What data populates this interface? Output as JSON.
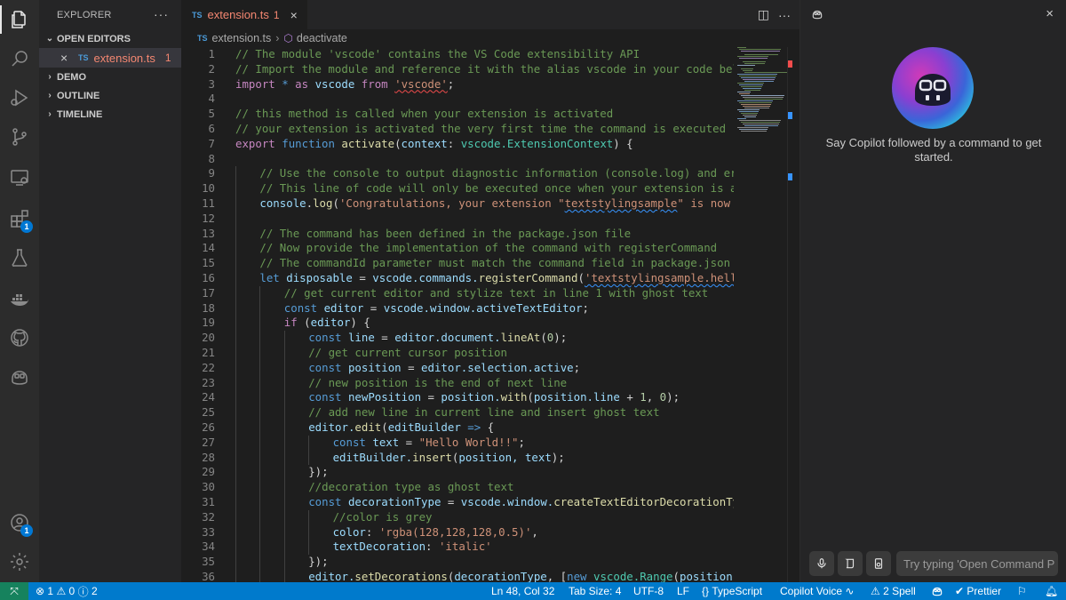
{
  "activity_bar": {
    "items": [
      "explorer-icon",
      "search-icon",
      "run-debug-icon",
      "source-control-icon",
      "remote-explorer-icon",
      "extensions-icon",
      "testing-icon",
      "docker-icon",
      "github-icon",
      "copilot-icon"
    ],
    "extensions_badge": "1",
    "accounts_badge": "1"
  },
  "sidebar": {
    "title": "EXPLORER",
    "more": "···",
    "sections": {
      "open_editors": "OPEN EDITORS",
      "demo": "DEMO",
      "outline": "OUTLINE",
      "timeline": "TIMELINE"
    },
    "open_file": {
      "icon": "TS",
      "name": "extension.ts",
      "problems": "1"
    }
  },
  "editor": {
    "tab": {
      "icon": "TS",
      "name": "extension.ts",
      "problems": "1"
    },
    "breadcrumb": {
      "file": "extension.ts",
      "symbol": "deactivate"
    }
  },
  "code": {
    "line_numbers": [
      "1",
      "2",
      "3",
      "4",
      "5",
      "6",
      "7",
      "8",
      "9",
      "10",
      "11",
      "12",
      "13",
      "14",
      "15",
      "16",
      "17",
      "18",
      "19",
      "20",
      "21",
      "22",
      "23",
      "24",
      "25",
      "26",
      "27",
      "28",
      "29",
      "30",
      "31",
      "32",
      "33",
      "34",
      "35",
      "36"
    ],
    "text": {
      "l1": "// The module 'vscode' contains the VS Code extensibility API",
      "l2": "// Import the module and reference it with the alias vscode in your code below",
      "l3_import": "import",
      "l3_star": "*",
      "l3_as": "as",
      "l3_vscode": "vscode",
      "l3_from": "from",
      "l3_mod": "'vscode'",
      "l5": "// this method is called when your extension is activated",
      "l6": "// your extension is activated the very first time the command is executed",
      "l7_export": "export",
      "l7_function": "function",
      "l7_name": "activate",
      "l7_param": "context",
      "l7_type": "vscode.ExtensionContext",
      "l9": "// Use the console to output diagnostic information (console.log) and errors (co",
      "l10": "// This line of code will only be executed once when your extension is activated",
      "l11_console": "console",
      "l11_log": "log",
      "l11_str1": "'Congratulations, your extension \"",
      "l11_str2": "textstylingsample",
      "l11_str3": "\" is now active!",
      "l13": "// The command has been defined in the package.json file",
      "l14": "// Now provide the implementation of the command with registerCommand",
      "l15": "// The commandId parameter must match the command field in package.json",
      "l16_let": "let",
      "l16_var": "disposable",
      "l16_obj": "vscode.commands.",
      "l16_fn": "registerCommand",
      "l16_str": "'textstylingsample.helloWorld'",
      "l17": "// get current editor and stylize text in line 1 with ghost text",
      "l18_const": "const",
      "l18_var": "editor",
      "l18_rhs": "vscode.window.activeTextEditor",
      "l19_if": "if",
      "l19_var": "editor",
      "l20_const": "const",
      "l20_var": "line",
      "l20_obj": "editor.document.",
      "l20_fn": "lineAt",
      "l20_num": "0",
      "l21": "// get current cursor position",
      "l22_const": "const",
      "l22_var": "position",
      "l22_rhs": "editor.selection.active",
      "l23": "// new position is the end of next line",
      "l24_const": "const",
      "l24_var": "newPosition",
      "l24_obj": "position.",
      "l24_fn": "with",
      "l24_arg": "position.line",
      "l24_num1": "1",
      "l24_num2": "0",
      "l25": "// add new line in current line and insert ghost text",
      "l26_obj": "editor.",
      "l26_fn": "edit",
      "l26_param": "editBuilder",
      "l27_const": "const",
      "l27_var": "text",
      "l27_str": "\"Hello World!!\"",
      "l28_obj": "editBuilder.",
      "l28_fn": "insert",
      "l28_args": "position, text",
      "l29": "});",
      "l30": "//decoration type as ghost text",
      "l31_const": "const",
      "l31_var": "decorationType",
      "l31_obj": "vscode.window.",
      "l31_fn": "createTextEditorDecorationType",
      "l32": "//color is grey",
      "l33_key": "color",
      "l33_str": "'rgba(128,128,128,0.5)'",
      "l34_key": "textDecoration",
      "l34_str": "'italic'",
      "l35": "});",
      "l36_obj": "editor.",
      "l36_fn": "setDecorations",
      "l36_arg": "decorationType",
      "l36_new": "new",
      "l36_cls": "vscode.Range",
      "l36_args": "position, newPo"
    }
  },
  "copilot": {
    "close": "×",
    "message": "Say Copilot followed by a command to get started.",
    "input_placeholder": "Try typing 'Open Command P"
  },
  "status_bar": {
    "errors": "1",
    "warnings": "0",
    "info": "2",
    "cursor": "Ln 48, Col 32",
    "tab_size": "Tab Size: 4",
    "encoding": "UTF-8",
    "eol": "LF",
    "language": "TypeScript",
    "copilot_voice": "Copilot Voice",
    "spell": "2 Spell",
    "prettier": "Prettier"
  }
}
